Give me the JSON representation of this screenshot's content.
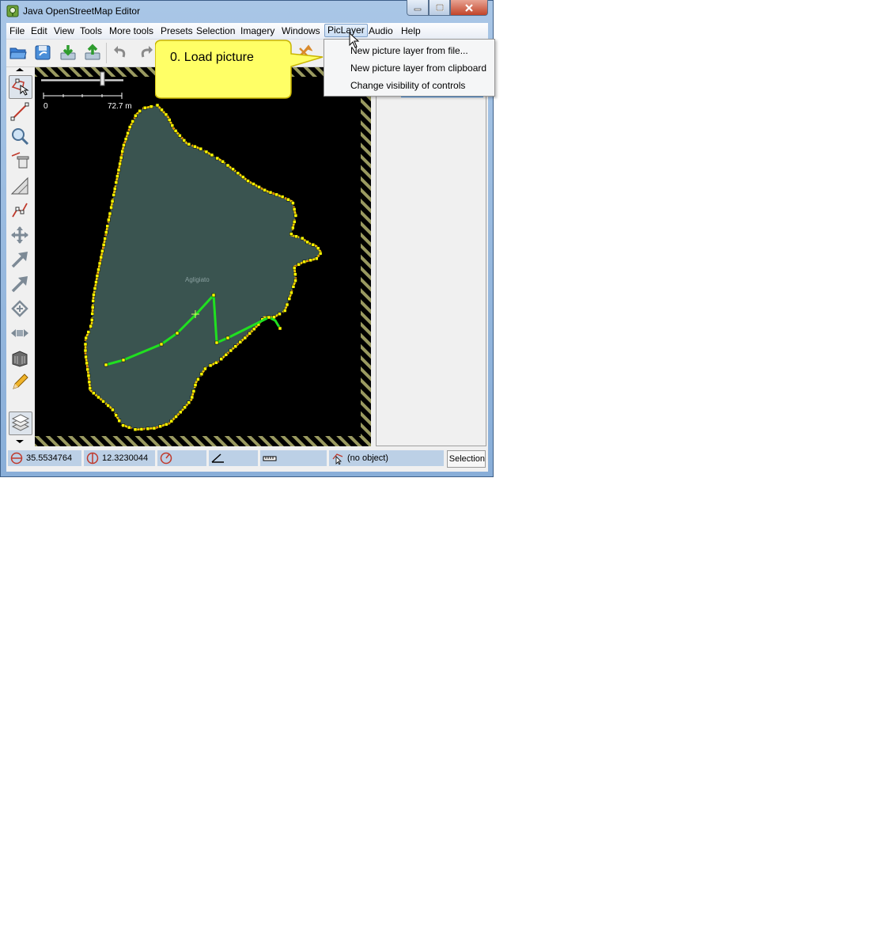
{
  "window": {
    "title": "Java OpenStreetMap Editor"
  },
  "menubar": {
    "items": [
      "File",
      "Edit",
      "View",
      "Tools",
      "More tools",
      "Presets",
      "Selection",
      "Imagery",
      "Windows",
      "PicLayer",
      "Audio",
      "Help"
    ],
    "active": "PicLayer"
  },
  "piclayer_menu": {
    "items": [
      "New picture layer from file...",
      "New picture layer from clipboard",
      "Change visibility of controls"
    ]
  },
  "callout": {
    "text": "0. Load picture"
  },
  "map": {
    "scale_start": "0",
    "scale_end": "72.7 m",
    "feature_label": "Agligiato",
    "colors": {
      "background": "#000000",
      "area_fill": "#3a5450",
      "outline": "#ffd000",
      "selected_way": "#20e020",
      "node": "#ffff00"
    }
  },
  "statusbar": {
    "lat": "35.5534764",
    "lon": "12.3230044",
    "object": "(no object)",
    "selection_button": "Selection"
  }
}
